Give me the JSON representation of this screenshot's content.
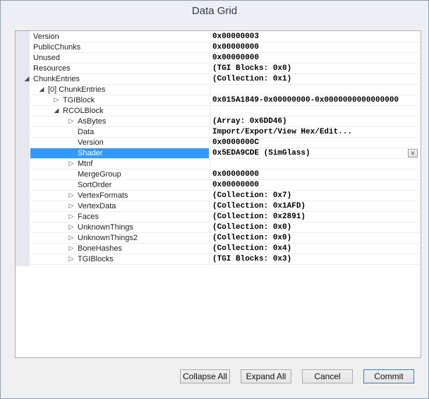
{
  "window": {
    "title": "Data Grid"
  },
  "grid": {
    "rows": [
      {
        "name": "Version",
        "value": "0x00000003",
        "indent": 0,
        "expander": ""
      },
      {
        "name": "PublicChunks",
        "value": "0x00000000",
        "indent": 0,
        "expander": ""
      },
      {
        "name": "Unused",
        "value": "0x00000000",
        "indent": 0,
        "expander": ""
      },
      {
        "name": "Resources",
        "value": "(TGI Blocks: 0x0)",
        "indent": 0,
        "expander": ""
      },
      {
        "name": "ChunkEntries",
        "value": "(Collection: 0x1)",
        "indent": 0,
        "expander": "expanded"
      },
      {
        "name": "[0] ChunkEntries",
        "value": "",
        "indent": 1,
        "expander": "expanded"
      },
      {
        "name": "TGIBlock",
        "value": "0x015A1849-0x00000000-0x0000000000000000",
        "indent": 2,
        "expander": "collapsed"
      },
      {
        "name": "RCOLBlock",
        "value": "",
        "indent": 2,
        "expander": "expanded"
      },
      {
        "name": "AsBytes",
        "value": "(Array: 0x6DD46)",
        "indent": 3,
        "expander": "collapsed"
      },
      {
        "name": "Data",
        "value": "Import/Export/View Hex/Edit...",
        "indent": 3,
        "expander": ""
      },
      {
        "name": "Version",
        "value": "0x0000000C",
        "indent": 3,
        "expander": ""
      },
      {
        "name": "Shader",
        "value": "0x5EDA9CDE (SimGlass)",
        "indent": 3,
        "expander": "",
        "selected": true,
        "dropdown": true
      },
      {
        "name": "Mtnf",
        "value": "",
        "indent": 3,
        "expander": "collapsed"
      },
      {
        "name": "MergeGroup",
        "value": "0x00000000",
        "indent": 3,
        "expander": ""
      },
      {
        "name": "SortOrder",
        "value": "0x00000000",
        "indent": 3,
        "expander": ""
      },
      {
        "name": "VertexFormats",
        "value": "(Collection: 0x7)",
        "indent": 3,
        "expander": "collapsed"
      },
      {
        "name": "VertexData",
        "value": "(Collection: 0x1AFD)",
        "indent": 3,
        "expander": "collapsed"
      },
      {
        "name": "Faces",
        "value": "(Collection: 0x2891)",
        "indent": 3,
        "expander": "collapsed"
      },
      {
        "name": "UnknownThings",
        "value": "(Collection: 0x0)",
        "indent": 3,
        "expander": "collapsed"
      },
      {
        "name": "UnknownThings2",
        "value": "(Collection: 0x0)",
        "indent": 3,
        "expander": "collapsed"
      },
      {
        "name": "BoneHashes",
        "value": "(Collection: 0x4)",
        "indent": 3,
        "expander": "collapsed"
      },
      {
        "name": "TGIBlocks",
        "value": "(TGI Blocks: 0x3)",
        "indent": 3,
        "expander": "collapsed"
      }
    ]
  },
  "buttons": {
    "collapse_all": "Collapse All",
    "expand_all": "Expand All",
    "cancel": "Cancel",
    "commit": "Commit"
  },
  "icons": {
    "expanded": "expanded-triangle-icon",
    "collapsed": "collapsed-triangle-icon",
    "dropdown": "chevron-down-icon"
  },
  "colors": {
    "selection": "#3399ff",
    "default_button_border": "#3c7fb1"
  }
}
